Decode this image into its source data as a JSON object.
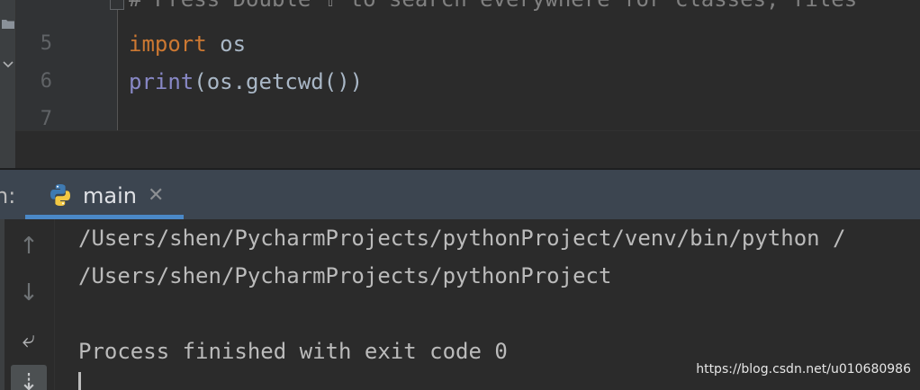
{
  "editor": {
    "cut_line_text": "# Press Double ⇧ to search everywhere for classes, files",
    "lines": [
      {
        "number": "5",
        "keyword": "import",
        "rest": " os"
      },
      {
        "number": "6",
        "builtin": "print",
        "rest": "(os.getcwd())"
      },
      {
        "number": "7"
      }
    ]
  },
  "run_window": {
    "label": "n:",
    "tab": {
      "label": "main",
      "icon": "python-icon",
      "close": "✕"
    },
    "toolbar": {
      "up_icon": "↑",
      "down_icon": "↓",
      "wrap_icon": "⤶",
      "scroll_icon": "⇣"
    },
    "output": [
      "/Users/shen/PycharmProjects/pythonProject/venv/bin/python /",
      "/Users/shen/PycharmProjects/pythonProject",
      "",
      "Process finished with exit code 0"
    ]
  },
  "watermark": "https://blog.csdn.net/u010680986",
  "colors": {
    "keyword": "#cc7832",
    "builtin": "#8888c6",
    "code": "#a9b7c6",
    "tab_underline": "#4a88c7",
    "header_bg": "#3c4550"
  }
}
